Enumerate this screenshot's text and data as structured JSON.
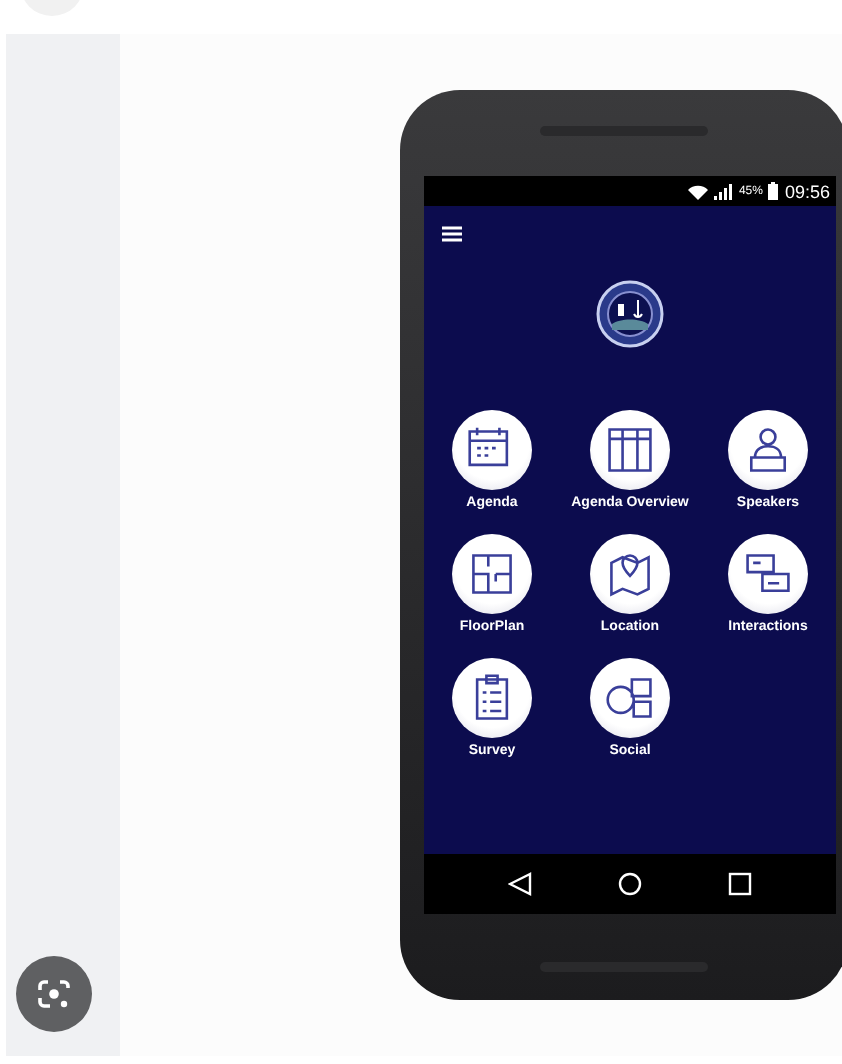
{
  "status_bar": {
    "battery": "45%",
    "time": "09:56"
  },
  "menu": [
    {
      "label": "Agenda"
    },
    {
      "label": "Agenda Overview"
    },
    {
      "label": "Speakers"
    },
    {
      "label": "FloorPlan"
    },
    {
      "label": "Location"
    },
    {
      "label": "Interactions"
    },
    {
      "label": "Survey"
    },
    {
      "label": "Social"
    }
  ]
}
